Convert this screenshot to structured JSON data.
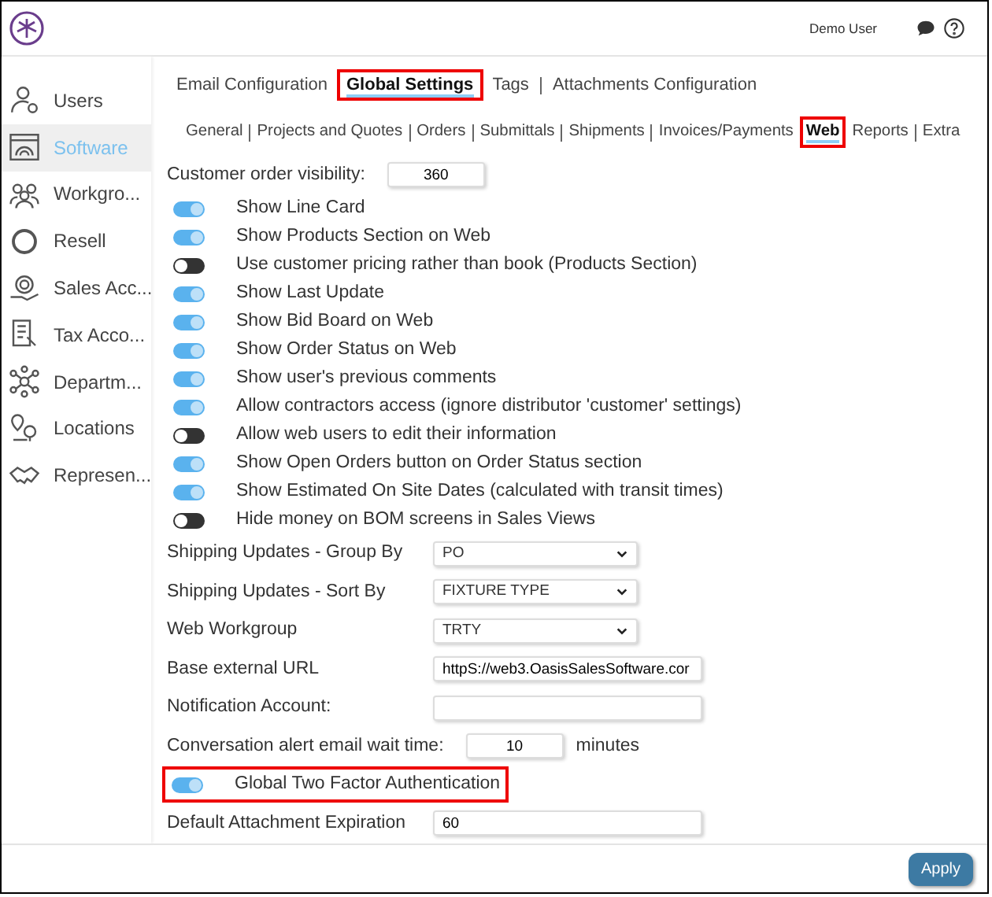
{
  "header": {
    "user": "Demo User"
  },
  "sidebar": {
    "items": [
      {
        "label": "Users",
        "selected": false
      },
      {
        "label": "Software",
        "selected": true
      },
      {
        "label": "Workgro...",
        "selected": false
      },
      {
        "label": "Resell",
        "selected": false
      },
      {
        "label": "Sales Acc...",
        "selected": false
      },
      {
        "label": "Tax Acco...",
        "selected": false
      },
      {
        "label": "Departm...",
        "selected": false
      },
      {
        "label": "Locations",
        "selected": false
      },
      {
        "label": "Represen...",
        "selected": false
      }
    ]
  },
  "tabs": [
    {
      "label": "Email Configuration",
      "selected": false,
      "highlighted": false
    },
    {
      "label": "Global Settings",
      "selected": true,
      "highlighted": true
    },
    {
      "label": "Tags",
      "selected": false,
      "highlighted": false
    },
    {
      "label": "Attachments Configuration",
      "selected": false,
      "highlighted": false
    }
  ],
  "subtabs": [
    {
      "label": "General",
      "selected": false,
      "highlighted": false
    },
    {
      "label": "Projects and Quotes",
      "selected": false,
      "highlighted": false
    },
    {
      "label": "Orders",
      "selected": false,
      "highlighted": false
    },
    {
      "label": "Submittals",
      "selected": false,
      "highlighted": false
    },
    {
      "label": "Shipments",
      "selected": false,
      "highlighted": false
    },
    {
      "label": "Invoices/Payments",
      "selected": false,
      "highlighted": false
    },
    {
      "label": "Web",
      "selected": true,
      "highlighted": true
    },
    {
      "label": "Reports",
      "selected": false,
      "highlighted": false
    },
    {
      "label": "Extra",
      "selected": false,
      "highlighted": false
    }
  ],
  "settings": [
    {
      "kind": "number",
      "label": "Customer order visibility:",
      "value": "360"
    },
    {
      "kind": "toggle",
      "label": "Show Line Card",
      "on": true,
      "highlighted": false
    },
    {
      "kind": "toggle",
      "label": "Show Products Section on Web",
      "on": true,
      "highlighted": false
    },
    {
      "kind": "toggle",
      "label": "Use customer pricing rather than book (Products Section)",
      "on": false,
      "highlighted": false
    },
    {
      "kind": "toggle",
      "label": "Show Last Update",
      "on": true,
      "highlighted": false
    },
    {
      "kind": "toggle",
      "label": "Show Bid Board on Web",
      "on": true,
      "highlighted": false
    },
    {
      "kind": "toggle",
      "label": "Show Order Status on Web",
      "on": true,
      "highlighted": false
    },
    {
      "kind": "toggle",
      "label": "Show user's previous comments",
      "on": true,
      "highlighted": false
    },
    {
      "kind": "toggle",
      "label": "Allow contractors access (ignore distributor 'customer' settings)",
      "on": true,
      "highlighted": false
    },
    {
      "kind": "toggle",
      "label": "Allow web users to edit their information",
      "on": false,
      "highlighted": false
    },
    {
      "kind": "toggle",
      "label": "Show Open Orders button on Order Status section",
      "on": true,
      "highlighted": false
    },
    {
      "kind": "toggle",
      "label": "Show Estimated On Site Dates (calculated with transit times)",
      "on": true,
      "highlighted": false
    },
    {
      "kind": "toggle",
      "label": "Hide money on BOM screens in Sales Views",
      "on": false,
      "highlighted": false
    },
    {
      "kind": "select",
      "label": "Shipping Updates - Group By",
      "value": "PO"
    },
    {
      "kind": "select",
      "label": "Shipping Updates - Sort By",
      "value": "FIXTURE TYPE"
    },
    {
      "kind": "select",
      "label": "Web Workgroup",
      "value": "TRTY"
    },
    {
      "kind": "text",
      "label": "Base external URL",
      "value": "httpS://web3.OasisSalesSoftware.cor"
    },
    {
      "kind": "text",
      "label": "Notification Account:"
    },
    {
      "kind": "number",
      "label": "Conversation alert email wait time:",
      "value": "10",
      "suffix": "minutes"
    },
    {
      "kind": "toggle",
      "label": "Global Two Factor Authentication",
      "on": true,
      "highlighted": true
    },
    {
      "kind": "text",
      "label": "Default Attachment Expiration",
      "value": "60"
    }
  ],
  "footer": {
    "button": "Apply"
  }
}
